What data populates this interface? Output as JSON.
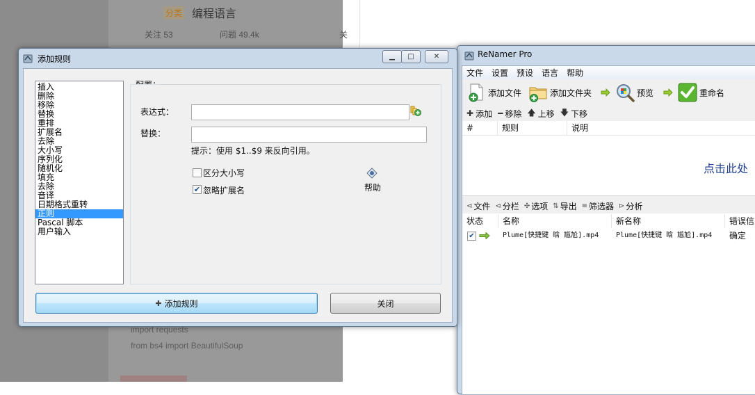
{
  "background": {
    "tag": "分类",
    "title": "编程语言",
    "follow": "关注 53",
    "questions": "问题 49.4k",
    "extra": "关",
    "code_line_1": "import requests",
    "code_line_2": "from bs4 import BeautifulSoup"
  },
  "dialog": {
    "title": "添加规则",
    "rules": [
      "插入",
      "删除",
      "移除",
      "替换",
      "重排",
      "扩展名",
      "去除",
      "大小写",
      "序列化",
      "随机化",
      "填充",
      "去除",
      "音译",
      "日期格式重转",
      "正则",
      "Pascal 脚本",
      "用户输入"
    ],
    "selected_rule": "正则",
    "config_label": "配置：",
    "expression_label": "表达式：",
    "expression_value": "",
    "replace_label": "替换：",
    "replace_value": "",
    "hint": "提示：使用 $1..$9 来反向引用。",
    "case_sensitive_label": "区分大小写",
    "case_sensitive_checked": false,
    "ignore_ext_label": "忽略扩展名",
    "ignore_ext_checked": true,
    "help_label": "帮助",
    "add_rule_button": "添加规则",
    "close_button": "关闭"
  },
  "renamer": {
    "title": "ReNamer Pro",
    "menu": [
      "文件",
      "设置",
      "预设",
      "语言",
      "帮助"
    ],
    "toolbar": {
      "add_files": "添加文件",
      "add_folders": "添加文件夹",
      "preview": "预览",
      "rename": "重命名"
    },
    "rules_bar": {
      "add": "添加",
      "remove": "移除",
      "move_up": "上移",
      "move_down": "下移"
    },
    "rules_columns": [
      "#",
      "规则",
      "说明"
    ],
    "click_hint": "点击此处",
    "files_bar": [
      "文件",
      "分栏",
      "选项",
      "导出",
      "筛选器",
      "分析"
    ],
    "files_columns": [
      "状态",
      "名称",
      "新名称",
      "错误信息"
    ],
    "files": [
      {
        "checked": true,
        "name": "Plume[快捷键 晗 尴尬].mp4",
        "new_name": "Plume[快捷键 晗 尴尬].mp4",
        "error": "确定"
      }
    ]
  },
  "colors": {
    "selection": "#3399ff",
    "window_frame": "#cad9ea",
    "hint_text": "#1f3f8f"
  }
}
